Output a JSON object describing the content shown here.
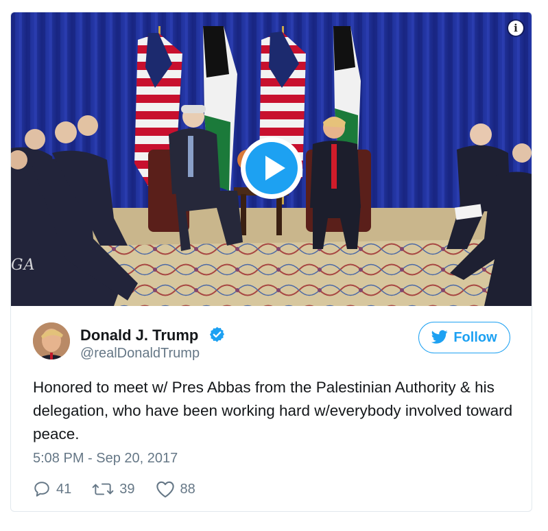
{
  "tweet": {
    "author_name": "Donald J. Trump",
    "author_handle": "@realDonaldTrump",
    "follow_label": "Follow",
    "text": "Honored to meet w/ Pres Abbas from the Palestinian Authority & his delegation, who have been working hard w/everybody involved toward peace.",
    "timestamp": "5:08 PM - Sep 20, 2017",
    "reply_count": "41",
    "retweet_count": "39",
    "like_count": "88"
  },
  "media": {
    "watermark": "GA",
    "info_label": "i"
  },
  "colors": {
    "accent": "#1da1f2",
    "muted": "#657786",
    "text": "#14171a",
    "border": "#e1e8ed"
  },
  "icons": {
    "verified": "verified-badge-icon",
    "twitter_bird": "twitter-bird-icon",
    "reply": "reply-icon",
    "retweet": "retweet-icon",
    "like": "heart-icon",
    "play": "play-icon",
    "info": "info-icon"
  }
}
